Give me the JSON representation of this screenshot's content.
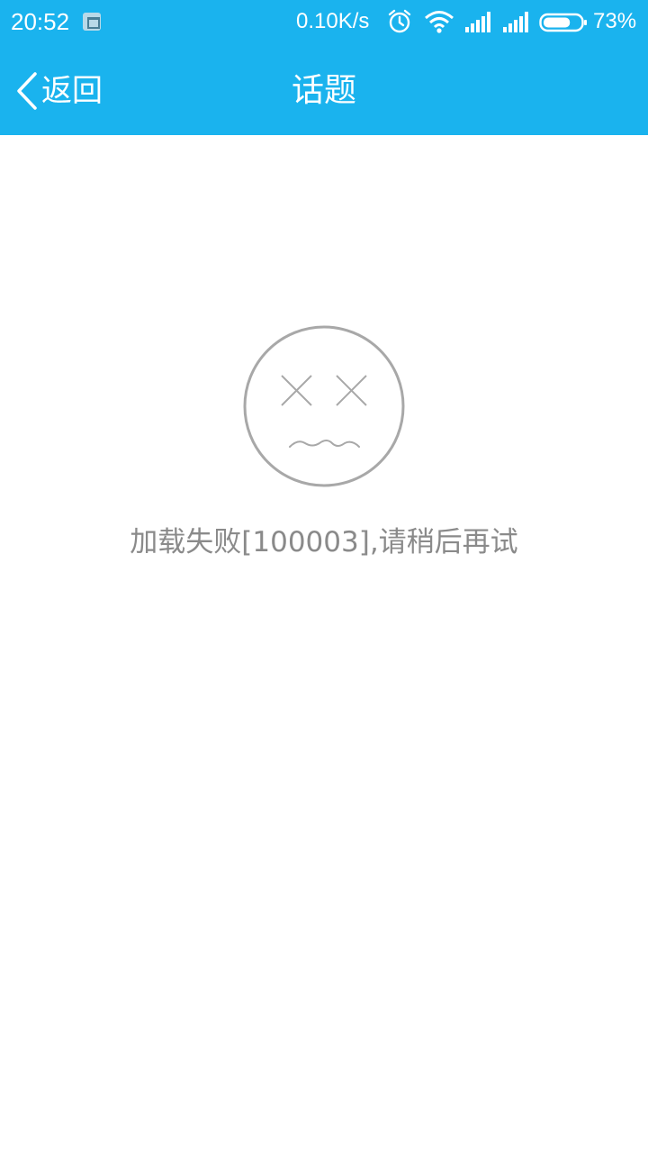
{
  "status_bar": {
    "time": "20:52",
    "net_speed": "0.10K/s",
    "battery_pct": "73%",
    "battery_level": 0.73,
    "icons": [
      "notification-icon",
      "alarm-icon",
      "wifi-icon",
      "signal-icon",
      "signal-icon",
      "battery-icon"
    ]
  },
  "nav": {
    "back_label": "返回",
    "title": "话题"
  },
  "error": {
    "icon": "sad-face-icon",
    "message": "加载失败[100003],请稍后再试"
  },
  "colors": {
    "header_bg": "#1ab3ee",
    "error_text": "#8a8a8a",
    "icon_stroke": "#a8a8a8"
  }
}
